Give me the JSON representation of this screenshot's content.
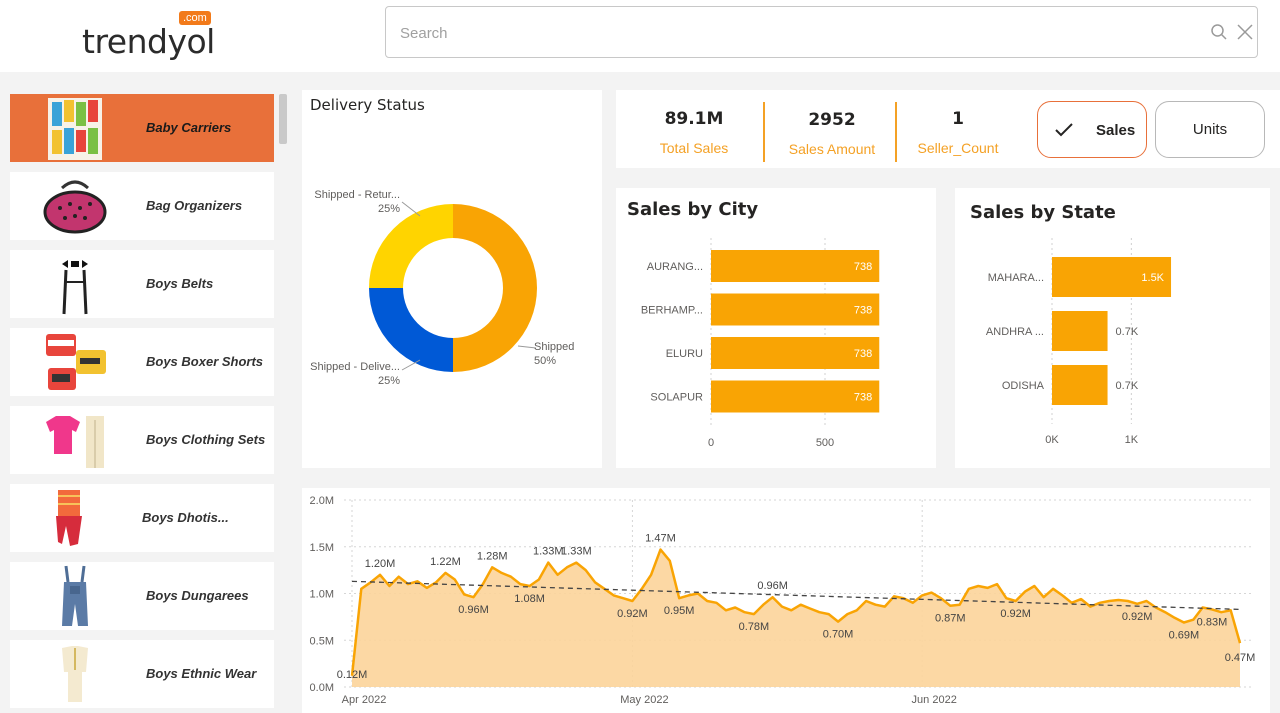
{
  "header": {
    "logo_text": "trendyol",
    "logo_badge": ".com",
    "search": {
      "placeholder": "Search",
      "value": ""
    },
    "search_icon": "search-icon",
    "close_icon": "close-icon"
  },
  "sidebar": {
    "items": [
      {
        "label": "Baby Carriers",
        "active": true
      },
      {
        "label": "Bag Organizers",
        "active": false
      },
      {
        "label": "Boys Belts",
        "active": false
      },
      {
        "label": "Boys Boxer Shorts",
        "active": false
      },
      {
        "label": "Boys Clothing Sets",
        "active": false
      },
      {
        "label": "Boys Dhotis...",
        "active": false
      },
      {
        "label": "Boys Dungarees",
        "active": false
      },
      {
        "label": "Boys Ethnic Wear",
        "active": false
      }
    ]
  },
  "kpis": [
    {
      "value": "89.1M",
      "label": "Total Sales"
    },
    {
      "value": "2952",
      "label": "Sales Amount"
    },
    {
      "value": "1",
      "label": "Seller_Count"
    }
  ],
  "toggle": {
    "sales_label": "Sales",
    "units_label": "Units",
    "selected": "Sales"
  },
  "colors": {
    "accent": "#f4a125",
    "selected": "#e8703a",
    "blue": "#0059d6",
    "yellow": "#ffd400"
  },
  "chart_data": [
    {
      "type": "pie",
      "title": "Delivery Status",
      "donut": true,
      "slices": [
        {
          "label": "Shipped",
          "value": 50,
          "pct_label": "50%",
          "color": "#f9a404"
        },
        {
          "label": "Shipped - Delive...",
          "value": 25,
          "pct_label": "25%",
          "color": "#0059d6"
        },
        {
          "label": "Shipped - Retur...",
          "value": 25,
          "pct_label": "25%",
          "color": "#ffd400"
        }
      ]
    },
    {
      "type": "bar",
      "orientation": "horizontal",
      "title": "Sales by City",
      "categories": [
        "AURANG...",
        "BERHAMP...",
        "ELURU",
        "SOLAPUR"
      ],
      "values": [
        738,
        738,
        738,
        738
      ],
      "value_labels": [
        "738",
        "738",
        "738",
        "738"
      ],
      "xticks": [
        "0",
        "500"
      ],
      "xtick_values": [
        0,
        500
      ],
      "xlim": [
        0,
        750
      ],
      "grid": true
    },
    {
      "type": "bar",
      "orientation": "horizontal",
      "title": "Sales by State",
      "categories": [
        "MAHARA...",
        "ANDHRA ...",
        "ODISHA"
      ],
      "values": [
        1500,
        700,
        700
      ],
      "value_labels": [
        "1.5K",
        "0.7K",
        "0.7K"
      ],
      "xticks": [
        "0K",
        "1K"
      ],
      "xtick_values": [
        0,
        1000
      ],
      "xlim": [
        0,
        1550
      ],
      "grid": true
    },
    {
      "type": "area",
      "title": "",
      "x_start": "2022-04-01",
      "xticks": [
        {
          "label": "Apr 2022",
          "day": 0
        },
        {
          "label": "May 2022",
          "day": 30
        },
        {
          "label": "Jun 2022",
          "day": 61
        }
      ],
      "yticks": [
        "0.0M",
        "0.5M",
        "1.0M",
        "1.5M",
        "2.0M"
      ],
      "ytick_values": [
        0,
        0.5,
        1.0,
        1.5,
        2.0
      ],
      "ylim": [
        0,
        2.0
      ],
      "trendline": {
        "start": 1.13,
        "end": 0.83
      },
      "values": [
        0.12,
        1.05,
        1.12,
        1.2,
        1.08,
        1.18,
        1.1,
        1.13,
        1.06,
        1.12,
        1.22,
        1.15,
        0.99,
        0.96,
        1.1,
        1.28,
        1.22,
        1.18,
        1.1,
        1.08,
        1.15,
        1.33,
        1.2,
        1.28,
        1.33,
        1.25,
        1.12,
        1.05,
        0.98,
        0.95,
        0.92,
        1.05,
        1.2,
        1.47,
        1.35,
        0.95,
        0.98,
        1.0,
        0.92,
        0.9,
        0.82,
        0.85,
        0.8,
        0.78,
        0.88,
        0.96,
        0.86,
        0.82,
        0.88,
        0.84,
        0.8,
        0.78,
        0.7,
        0.78,
        0.82,
        0.92,
        0.88,
        0.86,
        0.97,
        0.95,
        0.9,
        0.98,
        1.01,
        0.95,
        0.87,
        0.88,
        1.05,
        1.08,
        1.06,
        1.1,
        0.95,
        0.92,
        1.02,
        1.08,
        0.96,
        1.05,
        0.98,
        0.9,
        0.94,
        0.86,
        0.9,
        0.92,
        0.93,
        0.92,
        0.89,
        0.92,
        0.85,
        0.8,
        0.74,
        0.69,
        0.72,
        0.85,
        0.83,
        0.8,
        0.82,
        0.47
      ],
      "point_labels": [
        {
          "i": 0,
          "text": "0.12M"
        },
        {
          "i": 3,
          "text": "1.20M"
        },
        {
          "i": 10,
          "text": "1.22M"
        },
        {
          "i": 13,
          "text": "0.96M"
        },
        {
          "i": 15,
          "text": "1.28M"
        },
        {
          "i": 19,
          "text": "1.08M"
        },
        {
          "i": 21,
          "text": "1.33M"
        },
        {
          "i": 24,
          "text": "1.33M"
        },
        {
          "i": 30,
          "text": "0.92M"
        },
        {
          "i": 33,
          "text": "1.47M"
        },
        {
          "i": 35,
          "text": "0.95M"
        },
        {
          "i": 43,
          "text": "0.78M"
        },
        {
          "i": 45,
          "text": "0.96M"
        },
        {
          "i": 52,
          "text": "0.70M"
        },
        {
          "i": 64,
          "text": "0.87M"
        },
        {
          "i": 71,
          "text": "0.92M"
        },
        {
          "i": 84,
          "text": "0.92M"
        },
        {
          "i": 89,
          "text": "0.69M"
        },
        {
          "i": 92,
          "text": "0.83M"
        },
        {
          "i": 95,
          "text": "0.47M"
        }
      ]
    }
  ]
}
